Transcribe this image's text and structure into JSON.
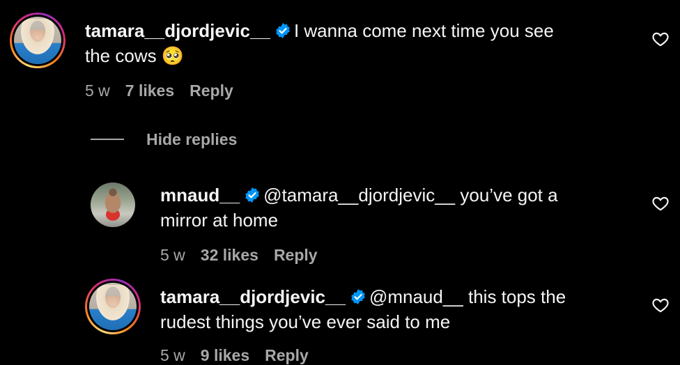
{
  "comments": [
    {
      "username": "tamara__djordjevic__",
      "text": "I wanna come next time you see the cows 🥺",
      "text_line1": "I wanna come next time you see",
      "text_line2": "the cows 🥺",
      "time": "5 w",
      "likes": "7 likes",
      "reply_label": "Reply"
    },
    {
      "username": "mnaud__",
      "mention": "@tamara__djordjevic__",
      "text_line1_rest": "you’ve got a",
      "text_line2": "mirror at home",
      "time": "5 w",
      "likes": "32 likes",
      "reply_label": "Reply"
    },
    {
      "username": "tamara__djordjevic__",
      "mention": "@mnaud__",
      "text_line1_rest": "this tops the",
      "text_line2": "rudest things you’ve ever said to me",
      "time": "5 w",
      "likes": "9 likes",
      "reply_label": "Reply"
    }
  ],
  "hide_replies_label": "Hide replies",
  "colors": {
    "background": "#000000",
    "text": "#f5f5f5",
    "secondary": "#a8a8a8",
    "verified": "#0095f6"
  }
}
